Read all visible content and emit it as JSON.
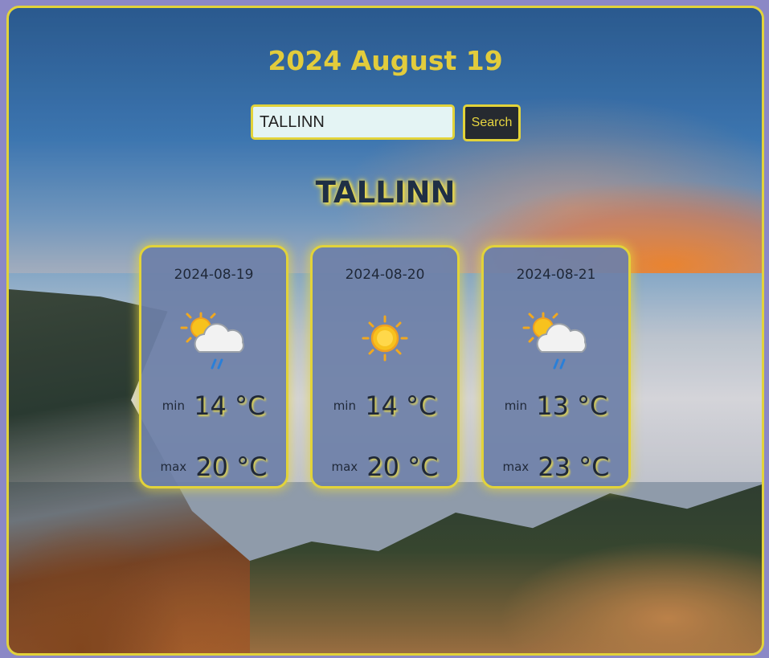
{
  "header": {
    "date_title": "2024 August 19"
  },
  "search": {
    "value": "TALLINN",
    "placeholder": "",
    "button_label": "Search"
  },
  "city": "TALLINN",
  "forecast": [
    {
      "date": "2024-08-19",
      "icon": "partly-cloudy-rain-icon",
      "min_label": "min",
      "min": "14 °C",
      "max_label": "max",
      "max": "20 °C"
    },
    {
      "date": "2024-08-20",
      "icon": "sun-icon",
      "min_label": "min",
      "min": "14 °C",
      "max_label": "max",
      "max": "20 °C"
    },
    {
      "date": "2024-08-21",
      "icon": "partly-cloudy-rain-icon",
      "min_label": "min",
      "min": "13 °C",
      "max_label": "max",
      "max": "23 °C"
    }
  ],
  "colors": {
    "accent": "#e2d33a",
    "card_bg": "#6e80a8",
    "button_bg": "#262a30",
    "input_bg": "#e4f4f4"
  }
}
